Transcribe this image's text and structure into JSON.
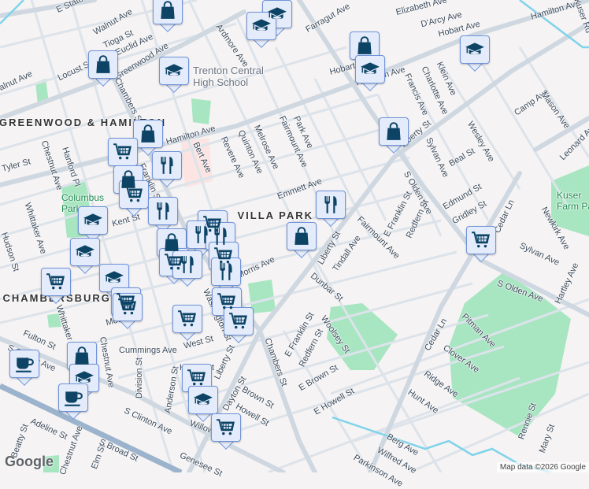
{
  "map": {
    "labels": [
      "E State St",
      "Walnut Ave",
      "Tioga St",
      "Euclid Ave",
      "Locust St",
      "Walnut Ave",
      "Greenwood Ave",
      "Chambers St",
      "Ardmore Ave",
      "Trenton Central\nHigh School",
      "GREENWOOD\n& HAMILTON",
      "Hamilton Ave",
      "Tyler St",
      "Chestnut Ave",
      "Hanford Pl",
      "Bert Ave",
      "Revere Ave",
      "Quinton Ave",
      "Melrose Ave",
      "Fairmount Ave",
      "Franklin St",
      "Columbus\nPark",
      "Kent St",
      "Whittaker Ave",
      "VILLA PARK",
      "Emmett Ave",
      "Park Ave",
      "Farragut Ave",
      "Elizabeth Ave",
      "D'Arcy Ave",
      "Hobart Ave",
      "Hamilton Ave",
      "Hamilton Ave",
      "Francis Ave",
      "Charlotte Ave",
      "Klein Ave",
      "Liberty St",
      "S Olden Ave",
      "Sylvan Ave",
      "Beal St",
      "Wesley Ave",
      "Camp Ave",
      "Mason Ave",
      "Leonard Ave",
      "Edmund St",
      "Gridley St",
      "E Franklin St",
      "Redfern St",
      "Fairmount Ave",
      "Liberty St",
      "Tindall Ave",
      "Dunbar St",
      "Cedar Ln",
      "Sylvan Ave",
      "Newkirk Ave",
      "Hartley Ave",
      "S Olden Ave",
      "Kuser\nFarm Park",
      "Woolsey St",
      "Pitman Ave",
      "Clover Ave",
      "Ridge Ave",
      "Hunt Ave",
      "Cedar Ln",
      "E Brown St",
      "E Howell St",
      "Berg Ave",
      "Wilfred Ave",
      "Rennie St",
      "Mary St",
      "Parkinson Ave",
      "Chambers St",
      "E Franklin St",
      "Redfern St",
      "Washington St",
      "Liberty St",
      "West St",
      "Cummings Ave",
      "Morris Ave",
      "Hewitt St",
      "Division St",
      "Anderson St",
      "Chestnut Ave",
      "Dayton St",
      "Brown St",
      "Howell St",
      "Willow St",
      "S Clinton Ave",
      "S Clinton Ave",
      "Fulton St",
      "Whittaker Ave",
      "Adeline St",
      "Beatty St",
      "Chestnut Ave",
      "Elm St",
      "S Broad St",
      "Genesee St",
      "Mott Ave",
      "Hudson St",
      "CHAMBERSBURG",
      "Hobart Ave",
      "Kuser Rd"
    ],
    "marker_types": {
      "shop": "shopping-bag-icon",
      "school": "graduation-cap-icon",
      "cart": "shopping-cart-icon",
      "restaurant": "fork-knife-icon",
      "coffee": "coffee-cup-icon"
    },
    "attribution": "Map data ©2026 Google",
    "logo": "Google"
  },
  "colors": {
    "background": "#f5f3f3",
    "road": "#d3dbe3",
    "park": "#a8e6c2",
    "water": "#7fd3ea",
    "marker_bg": "#e4ecfb",
    "marker_icon": "#0d4466"
  }
}
